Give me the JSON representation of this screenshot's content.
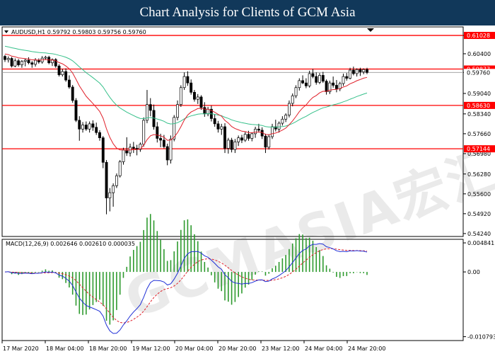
{
  "header": {
    "title": "Chart Analysis for Clients of GCM Asia"
  },
  "chart_data": [
    {
      "type": "candlestick",
      "title": "AUDUSD,H1  0.59792 0.59803 0.59756 0.59760",
      "x_ticks": [
        "17 Mar 2020",
        "18 Mar 04:00",
        "18 Mar 20:00",
        "19 Mar 12:00",
        "20 Mar 04:00",
        "20 Mar 20:00",
        "23 Mar 12:00",
        "24 Mar 04:00",
        "24 Mar 20:00"
      ],
      "y_ticks": [
        0.61028,
        0.604,
        0.5976,
        0.5904,
        0.5834,
        0.5766,
        0.5698,
        0.5628,
        0.556,
        0.5492,
        0.5424
      ],
      "ylim": [
        0.5414,
        0.6132
      ],
      "current_price": 0.5976,
      "levels": [
        0.61028,
        0.59877,
        0.5863,
        0.57144
      ],
      "ma_colors": {
        "fast": "#e0202a",
        "slow": "#36c08a"
      },
      "candles_ohlc": [
        [
          0.6031,
          0.6036,
          0.6012,
          0.602
        ],
        [
          0.602,
          0.6031,
          0.601,
          0.6024
        ],
        [
          0.6024,
          0.6029,
          0.5993,
          0.5998
        ],
        [
          0.5998,
          0.6024,
          0.5994,
          0.6016
        ],
        [
          0.6016,
          0.6022,
          0.5996,
          0.6002
        ],
        [
          0.6002,
          0.6018,
          0.5992,
          0.6014
        ],
        [
          0.6014,
          0.6024,
          0.5997,
          0.6018
        ],
        [
          0.6018,
          0.6028,
          0.6004,
          0.6009
        ],
        [
          0.6009,
          0.6015,
          0.5992,
          0.6004
        ],
        [
          0.6004,
          0.6025,
          0.5996,
          0.6018
        ],
        [
          0.6018,
          0.6024,
          0.6006,
          0.6012
        ],
        [
          0.6012,
          0.6032,
          0.6006,
          0.6025
        ],
        [
          0.6025,
          0.6033,
          0.602,
          0.6028
        ],
        [
          0.6028,
          0.6033,
          0.6004,
          0.6009
        ],
        [
          0.6009,
          0.6024,
          0.5998,
          0.602
        ],
        [
          0.602,
          0.6025,
          0.5992,
          0.5998
        ],
        [
          0.5998,
          0.6004,
          0.5962,
          0.5968
        ],
        [
          0.5968,
          0.5988,
          0.5962,
          0.5979
        ],
        [
          0.5979,
          0.599,
          0.5944,
          0.595
        ],
        [
          0.595,
          0.5966,
          0.592,
          0.5926
        ],
        [
          0.5926,
          0.5933,
          0.5872,
          0.588
        ],
        [
          0.588,
          0.5888,
          0.5806,
          0.5812
        ],
        [
          0.5812,
          0.5826,
          0.5742,
          0.5782
        ],
        [
          0.5782,
          0.5806,
          0.577,
          0.5796
        ],
        [
          0.5796,
          0.5808,
          0.5776,
          0.5782
        ],
        [
          0.5782,
          0.5808,
          0.577,
          0.58
        ],
        [
          0.58,
          0.5812,
          0.5776,
          0.5788
        ],
        [
          0.5788,
          0.5804,
          0.5762,
          0.577
        ],
        [
          0.577,
          0.5778,
          0.5742,
          0.5752
        ],
        [
          0.5752,
          0.5758,
          0.5648,
          0.5668
        ],
        [
          0.5668,
          0.5676,
          0.549,
          0.5546
        ],
        [
          0.5546,
          0.558,
          0.55,
          0.5564
        ],
        [
          0.5564,
          0.5596,
          0.5516,
          0.5588
        ],
        [
          0.5588,
          0.563,
          0.558,
          0.5622
        ],
        [
          0.5622,
          0.5676,
          0.5616,
          0.567
        ],
        [
          0.567,
          0.5718,
          0.566,
          0.571
        ],
        [
          0.571,
          0.5754,
          0.569,
          0.57
        ],
        [
          0.57,
          0.5732,
          0.5688,
          0.572
        ],
        [
          0.572,
          0.5738,
          0.57,
          0.5716
        ],
        [
          0.5716,
          0.5728,
          0.5692,
          0.5712
        ],
        [
          0.5712,
          0.5736,
          0.5704,
          0.573
        ],
        [
          0.573,
          0.5822,
          0.5722,
          0.5812
        ],
        [
          0.5812,
          0.5916,
          0.5802,
          0.5866
        ],
        [
          0.5866,
          0.5888,
          0.5826,
          0.5846
        ],
        [
          0.5846,
          0.5866,
          0.578,
          0.579
        ],
        [
          0.579,
          0.5806,
          0.5736,
          0.575
        ],
        [
          0.575,
          0.5766,
          0.572,
          0.5744
        ],
        [
          0.5744,
          0.5762,
          0.5716,
          0.5722
        ],
        [
          0.5722,
          0.5732,
          0.5658,
          0.5676
        ],
        [
          0.5676,
          0.576,
          0.5664,
          0.5748
        ],
        [
          0.5748,
          0.583,
          0.574,
          0.5822
        ],
        [
          0.5822,
          0.588,
          0.5812,
          0.5866
        ],
        [
          0.5866,
          0.5932,
          0.5858,
          0.5924
        ],
        [
          0.5924,
          0.5976,
          0.5916,
          0.5962
        ],
        [
          0.5962,
          0.598,
          0.593,
          0.594
        ],
        [
          0.594,
          0.5952,
          0.59,
          0.5908
        ],
        [
          0.5908,
          0.5916,
          0.5876,
          0.5884
        ],
        [
          0.5884,
          0.5902,
          0.5868,
          0.5892
        ],
        [
          0.5892,
          0.5898,
          0.5848,
          0.5856
        ],
        [
          0.5856,
          0.5874,
          0.5824,
          0.5834
        ],
        [
          0.5834,
          0.5858,
          0.5826,
          0.585
        ],
        [
          0.585,
          0.5862,
          0.5808,
          0.5818
        ],
        [
          0.5818,
          0.5832,
          0.579,
          0.58
        ],
        [
          0.58,
          0.581,
          0.577,
          0.5782
        ],
        [
          0.5782,
          0.58,
          0.5762,
          0.579
        ],
        [
          0.579,
          0.5802,
          0.57,
          0.5716
        ],
        [
          0.5716,
          0.5752,
          0.5698,
          0.5744
        ],
        [
          0.5744,
          0.5752,
          0.5702,
          0.5712
        ],
        [
          0.5712,
          0.5748,
          0.57,
          0.5738
        ],
        [
          0.5738,
          0.576,
          0.5724,
          0.5752
        ],
        [
          0.5752,
          0.5762,
          0.5734,
          0.5744
        ],
        [
          0.5744,
          0.5772,
          0.5738,
          0.5764
        ],
        [
          0.5764,
          0.5776,
          0.5742,
          0.575
        ],
        [
          0.575,
          0.577,
          0.574,
          0.5766
        ],
        [
          0.5766,
          0.579,
          0.5752,
          0.5782
        ],
        [
          0.5782,
          0.58,
          0.577,
          0.5778
        ],
        [
          0.5778,
          0.5788,
          0.5748,
          0.5758
        ],
        [
          0.5758,
          0.5766,
          0.57,
          0.572
        ],
        [
          0.572,
          0.5764,
          0.5712,
          0.5756
        ],
        [
          0.5756,
          0.58,
          0.5748,
          0.579
        ],
        [
          0.579,
          0.5814,
          0.5774,
          0.5782
        ],
        [
          0.5782,
          0.5808,
          0.577,
          0.5802
        ],
        [
          0.5802,
          0.5826,
          0.5794,
          0.5816
        ],
        [
          0.5816,
          0.5836,
          0.5806,
          0.583
        ],
        [
          0.583,
          0.588,
          0.5822,
          0.587
        ],
        [
          0.587,
          0.5904,
          0.586,
          0.5896
        ],
        [
          0.5896,
          0.5932,
          0.5888,
          0.5924
        ],
        [
          0.5924,
          0.5956,
          0.5914,
          0.5948
        ],
        [
          0.5948,
          0.5966,
          0.5936,
          0.594
        ],
        [
          0.594,
          0.5956,
          0.5922,
          0.593
        ],
        [
          0.593,
          0.5982,
          0.5924,
          0.5972
        ],
        [
          0.5972,
          0.5988,
          0.5956,
          0.5962
        ],
        [
          0.5962,
          0.5976,
          0.5934,
          0.5942
        ],
        [
          0.5942,
          0.5974,
          0.5936,
          0.5966
        ],
        [
          0.5966,
          0.5978,
          0.594,
          0.5946
        ],
        [
          0.5946,
          0.5952,
          0.59,
          0.591
        ],
        [
          0.591,
          0.5948,
          0.5902,
          0.594
        ],
        [
          0.594,
          0.5962,
          0.5924,
          0.5932
        ],
        [
          0.5932,
          0.595,
          0.5908,
          0.592
        ],
        [
          0.592,
          0.5944,
          0.5912,
          0.5938
        ],
        [
          0.5938,
          0.5972,
          0.593,
          0.5962
        ],
        [
          0.5962,
          0.5974,
          0.5948,
          0.5956
        ],
        [
          0.5956,
          0.5992,
          0.5952,
          0.5984
        ],
        [
          0.5984,
          0.5996,
          0.5966,
          0.5972
        ],
        [
          0.5972,
          0.599,
          0.5962,
          0.5986
        ],
        [
          0.5986,
          0.5992,
          0.5964,
          0.5978
        ],
        [
          0.5978,
          0.599,
          0.597,
          0.5986
        ],
        [
          0.5986,
          0.5992,
          0.597,
          0.5976
        ]
      ]
    },
    {
      "type": "macd",
      "title": "MACD(12,26,9)  0.002646 0.002610 0.000035",
      "y_ticks": [
        0.004841,
        0.0,
        -0.010793
      ],
      "ylim": [
        -0.0112,
        0.0052
      ],
      "colors": {
        "histogram": "#2e9a2e",
        "macd": "#1f2fd6",
        "signal": "#e0202a"
      }
    }
  ]
}
